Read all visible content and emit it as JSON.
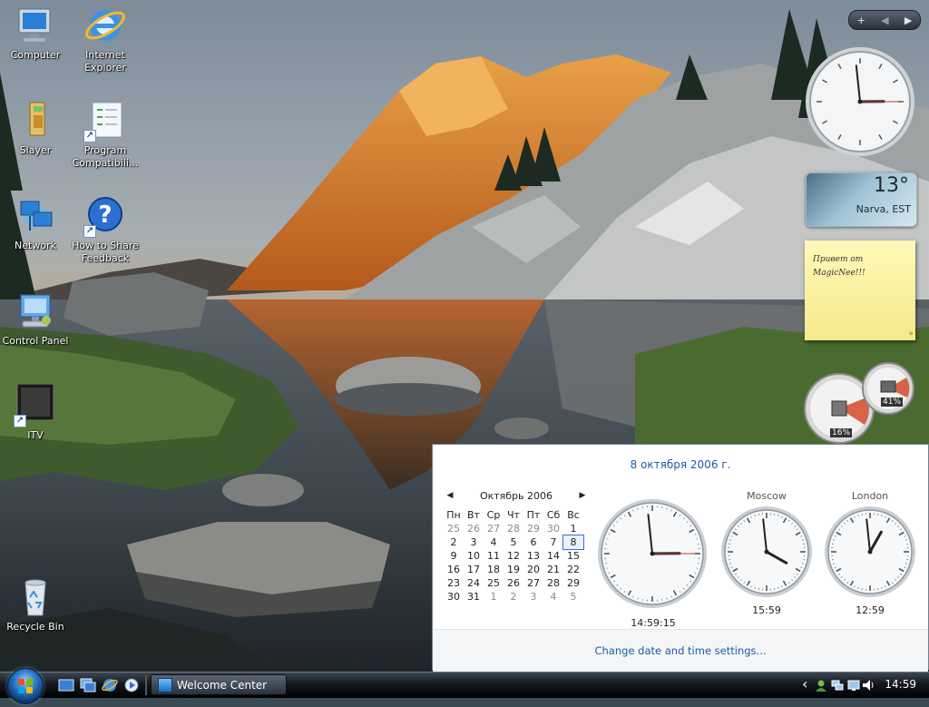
{
  "desktop": {
    "icons": [
      {
        "label": "Computer"
      },
      {
        "label": "Internet Explorer"
      },
      {
        "label": "Slayer"
      },
      {
        "label": "Program Compatibili..."
      },
      {
        "label": "Network"
      },
      {
        "label": "How to Share Feedback"
      },
      {
        "label": "Control Panel"
      },
      {
        "label": "ITV"
      },
      {
        "label": "Recycle Bin"
      }
    ]
  },
  "sidebar": {
    "controls": [
      "+",
      "◀",
      "▶"
    ],
    "weather": {
      "temp": "13°",
      "city": "Narva, EST"
    },
    "notes": {
      "text": "Привет от MagicNee!!!",
      "corner": "»"
    },
    "meter": {
      "cpu": "16%",
      "memory": "41%"
    }
  },
  "flyout": {
    "date_heading": "8 октября 2006 г.",
    "calendar": {
      "month_label": "Октябрь 2006",
      "weekdays": [
        "Пн",
        "Вт",
        "Ср",
        "Чт",
        "Пт",
        "Сб",
        "Вс"
      ],
      "weeks": [
        [
          "25",
          "26",
          "27",
          "28",
          "29",
          "30",
          "1"
        ],
        [
          "2",
          "3",
          "4",
          "5",
          "6",
          "7",
          "8"
        ],
        [
          "9",
          "10",
          "11",
          "12",
          "13",
          "14",
          "15"
        ],
        [
          "16",
          "17",
          "18",
          "19",
          "20",
          "21",
          "22"
        ],
        [
          "23",
          "24",
          "25",
          "26",
          "27",
          "28",
          "29"
        ],
        [
          "30",
          "31",
          "1",
          "2",
          "3",
          "4",
          "5"
        ]
      ],
      "today": "8"
    },
    "clocks": [
      {
        "city": "",
        "time": "14:59:15",
        "h": 14,
        "m": 59,
        "s": 15
      },
      {
        "city": "Moscow",
        "time": "15:59",
        "h": 15,
        "m": 59
      },
      {
        "city": "London",
        "time": "12:59",
        "h": 12,
        "m": 59
      }
    ],
    "settings_link": "Change date and time settings..."
  },
  "taskbar": {
    "task_label": "Welcome Center",
    "clock": "14:59",
    "tray_expand": "‹"
  },
  "colors": {
    "link": "#1f5ca8",
    "taskbar": "#14181e"
  }
}
